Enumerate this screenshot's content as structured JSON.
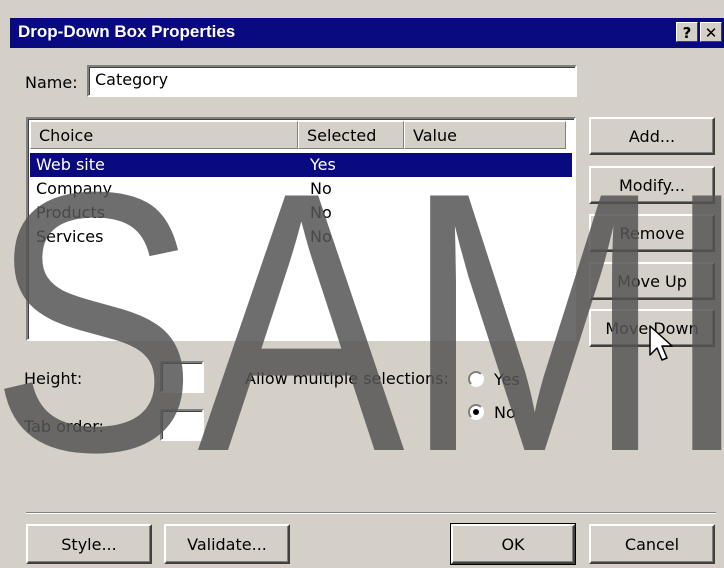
{
  "window": {
    "title": "Drop-Down Box Properties",
    "help_glyph": "?",
    "close_glyph": "✕"
  },
  "name_field": {
    "label": "Name:",
    "value": "Category"
  },
  "choices": {
    "headers": [
      "Choice",
      "Selected",
      "Value"
    ],
    "rows": [
      {
        "choice": "Web site",
        "selected": "Yes",
        "value": ""
      },
      {
        "choice": "Company",
        "selected": "No",
        "value": ""
      },
      {
        "choice": "Products",
        "selected": "No",
        "value": ""
      },
      {
        "choice": "Services",
        "selected": "No",
        "value": ""
      }
    ],
    "selected_row_index": 0
  },
  "side_buttons": {
    "add": "Add...",
    "modify": "Modify...",
    "remove": "Remove",
    "move_up": "Move Up",
    "move_down": "Move Down"
  },
  "height_field": {
    "label": "Height:",
    "value": ""
  },
  "tab_order_field": {
    "label": "Tab order:",
    "value": ""
  },
  "multiple_selections": {
    "label": "Allow multiple selections:",
    "options": [
      "Yes",
      "No"
    ],
    "selected": "No"
  },
  "bottom_buttons": {
    "style": "Style...",
    "validate": "Validate...",
    "ok": "OK",
    "cancel": "Cancel"
  },
  "watermark": {
    "text": "SAMI",
    "color": "#555555"
  },
  "colors": {
    "title_bar": "#0a0a80",
    "face": "#d4d0c8",
    "selection": "#0a0a80"
  }
}
